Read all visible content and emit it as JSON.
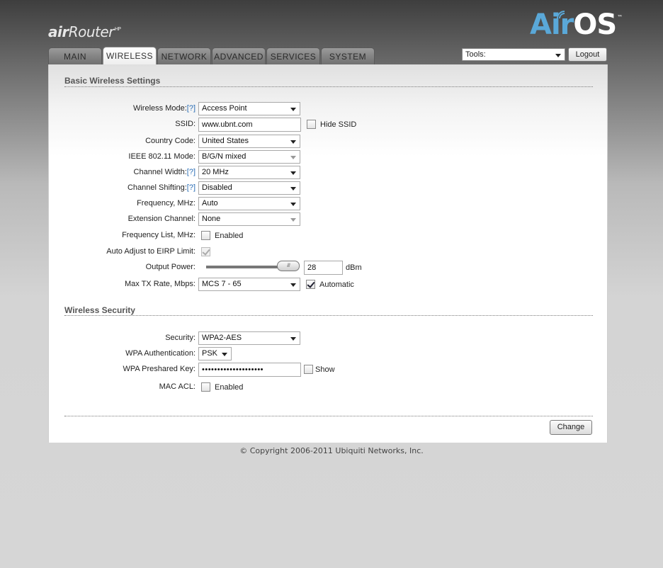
{
  "header": {
    "brand_main": "air",
    "brand_rest": "Router",
    "brand_sup": "HP",
    "logo_air": "Air",
    "logo_os": "OS",
    "logo_tm": "™",
    "colors": {
      "logo_blue": "#5aa8d8",
      "help_link": "#2a6db5"
    }
  },
  "tabs": [
    {
      "label": "MAIN"
    },
    {
      "label": "WIRELESS",
      "active": true
    },
    {
      "label": "NETWORK"
    },
    {
      "label": "ADVANCED"
    },
    {
      "label": "SERVICES"
    },
    {
      "label": "SYSTEM"
    }
  ],
  "tools": {
    "value": "Tools:"
  },
  "logout_label": "Logout",
  "basic": {
    "title": "Basic Wireless Settings",
    "help": "[?]",
    "wireless_mode": {
      "label": "Wireless Mode:",
      "value": "Access Point"
    },
    "ssid": {
      "label": "SSID:",
      "value": "www.ubnt.com",
      "hide_label": "Hide SSID",
      "hide_checked": false
    },
    "country": {
      "label": "Country Code:",
      "value": "United States"
    },
    "ieee": {
      "label": "IEEE 802.11 Mode:",
      "value": "B/G/N mixed",
      "disabled": true
    },
    "channel_width": {
      "label": "Channel Width:",
      "value": "20 MHz"
    },
    "channel_shifting": {
      "label": "Channel Shifting:",
      "value": "Disabled"
    },
    "frequency": {
      "label": "Frequency, MHz:",
      "value": "Auto"
    },
    "extension": {
      "label": "Extension Channel:",
      "value": "None",
      "disabled": true
    },
    "freq_list": {
      "label": "Frequency List, MHz:",
      "enabled_label": "Enabled",
      "checked": false
    },
    "eirp": {
      "label": "Auto Adjust to EIRP Limit:",
      "checked": true,
      "disabled": true
    },
    "output_power": {
      "label": "Output Power:",
      "value": "28",
      "unit": "dBm",
      "slider_fraction": 0.95
    },
    "max_tx": {
      "label": "Max TX Rate, Mbps:",
      "value": "MCS 7 - 65",
      "auto_label": "Automatic",
      "auto_checked": true
    }
  },
  "security": {
    "title": "Wireless Security",
    "security": {
      "label": "Security:",
      "value": "WPA2-AES"
    },
    "wpa_auth": {
      "label": "WPA Authentication:",
      "value": "PSK"
    },
    "psk": {
      "label": "WPA Preshared Key:",
      "value": "••••••••••••••••••••",
      "show_label": "Show",
      "show_checked": false
    },
    "mac_acl": {
      "label": "MAC ACL:",
      "enabled_label": "Enabled",
      "checked": false
    }
  },
  "change_label": "Change",
  "footer": "© Copyright 2006-2011 Ubiquiti Networks, Inc."
}
